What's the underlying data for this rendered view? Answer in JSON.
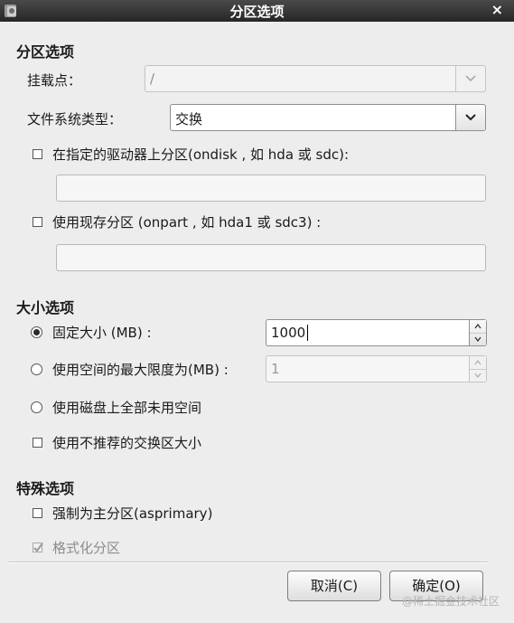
{
  "window": {
    "title": "分区选项",
    "close_glyph": "×",
    "app_icon": "anaconda-app-icon"
  },
  "partition_options": {
    "heading": "分区选项",
    "mount_point": {
      "label": "挂载点：",
      "value": "/",
      "enabled": false
    },
    "fs_type": {
      "label": "文件系统类型：",
      "value": "交换"
    },
    "ondisk": {
      "label": "在指定的驱动器上分区(ondisk , 如 hda 或 sdc):",
      "checked": false,
      "value": ""
    },
    "onpart": {
      "label": "使用现存分区 (onpart , 如 hda1 或 sdc3) :",
      "checked": false,
      "value": ""
    }
  },
  "size_options": {
    "heading": "大小选项",
    "fixed": {
      "label": "固定大小 (MB) :",
      "selected": true,
      "value": "1000"
    },
    "max": {
      "label": "使用空间的最大限度为(MB) :",
      "selected": false,
      "value": "1"
    },
    "all_space": {
      "label": "使用磁盘上全部未用空间",
      "selected": false
    },
    "recommended_swap": {
      "label": "使用不推荐的交换区大小",
      "checked": false
    }
  },
  "special_options": {
    "heading": "特殊选项",
    "asprimary": {
      "label": "强制为主分区(asprimary)",
      "checked": false
    },
    "format": {
      "label": "格式化分区",
      "checked": true,
      "enabled": false
    }
  },
  "buttons": {
    "cancel": "取消(C)",
    "ok": "确定(O)"
  },
  "watermark": "@稀土掘金技术社区"
}
